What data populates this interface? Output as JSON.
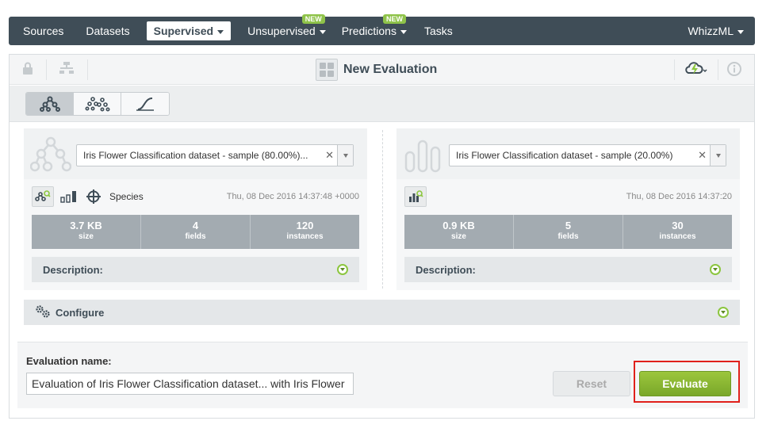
{
  "nav": {
    "items": [
      {
        "label": "Sources",
        "has_caret": false,
        "badge": ""
      },
      {
        "label": "Datasets",
        "has_caret": false,
        "badge": ""
      },
      {
        "label": "Supervised",
        "has_caret": true,
        "badge": "",
        "active": true
      },
      {
        "label": "Unsupervised",
        "has_caret": true,
        "badge": "NEW"
      },
      {
        "label": "Predictions",
        "has_caret": true,
        "badge": "NEW"
      },
      {
        "label": "Tasks",
        "has_caret": false,
        "badge": ""
      }
    ],
    "right_label": "WhizzML"
  },
  "titlebar": {
    "title": "New Evaluation",
    "icons": [
      "lock-icon",
      "tree-structure-icon",
      "cloud-power-icon",
      "info-icon"
    ]
  },
  "tabs": [
    "model-icon",
    "ensemble-icon",
    "logistic-curve-icon"
  ],
  "left_card": {
    "selected": "Iris Flower Classification dataset - sample (80.00%)...",
    "target": "Species",
    "timestamp": "Thu, 08 Dec 2016 14:37:48 +0000",
    "stats": [
      {
        "value": "3.7 KB",
        "label": "size"
      },
      {
        "value": "4",
        "label": "fields"
      },
      {
        "value": "120",
        "label": "instances"
      }
    ],
    "description_label": "Description:"
  },
  "right_card": {
    "selected": "Iris Flower Classification dataset - sample (20.00%)",
    "timestamp": "Thu, 08 Dec 2016 14:37:20",
    "stats": [
      {
        "value": "0.9 KB",
        "label": "size"
      },
      {
        "value": "5",
        "label": "fields"
      },
      {
        "value": "30",
        "label": "instances"
      }
    ],
    "description_label": "Description:"
  },
  "configure_label": "Configure",
  "footer": {
    "eval_name_label": "Evaluation name:",
    "eval_name_value": "Evaluation of Iris Flower Classification dataset... with Iris Flower",
    "reset_label": "Reset",
    "evaluate_label": "Evaluate"
  },
  "colors": {
    "nav_bg": "#3f4d57",
    "accent_green": "#8fc34a",
    "highlight_red": "#e0201b"
  }
}
